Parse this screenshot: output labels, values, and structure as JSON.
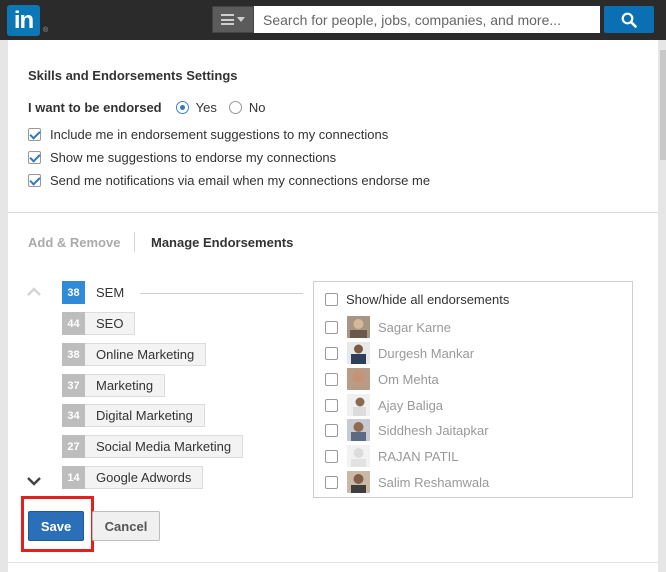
{
  "header": {
    "logo_text": "in",
    "logo_mark": "®",
    "search_placeholder": "Search for people, jobs, companies, and more..."
  },
  "settings": {
    "title": "Skills and Endorsements Settings",
    "endorse_label": "I want to be endorsed",
    "yes_label": "Yes",
    "no_label": "No",
    "endorse_value": "Yes",
    "checkboxes": [
      {
        "label": "Include me in endorsement suggestions to my connections",
        "checked": true
      },
      {
        "label": "Show me suggestions to endorse my connections",
        "checked": true
      },
      {
        "label": "Send me notifications via email when my connections endorse me",
        "checked": true
      }
    ]
  },
  "tabs": {
    "add_remove": "Add & Remove",
    "manage": "Manage Endorsements"
  },
  "skills": [
    {
      "count": "38",
      "name": "SEM"
    },
    {
      "count": "44",
      "name": "SEO"
    },
    {
      "count": "38",
      "name": "Online Marketing"
    },
    {
      "count": "37",
      "name": "Marketing"
    },
    {
      "count": "34",
      "name": "Digital Marketing"
    },
    {
      "count": "27",
      "name": "Social Media Marketing"
    },
    {
      "count": "14",
      "name": "Google Adwords"
    }
  ],
  "endorsers": {
    "toggle_label": "Show/hide all endorsements",
    "people": [
      "Sagar Karne",
      "Durgesh Mankar",
      "Om Mehta",
      "Ajay Baliga",
      "Siddhesh Jaitapkar",
      "RAJAN PATIL",
      "Salim Reshamwala"
    ]
  },
  "actions": {
    "save": "Save",
    "cancel": "Cancel"
  },
  "colors": {
    "brand": "#0b77b5",
    "accent": "#2f8ad7",
    "highlight": "#e0211d"
  }
}
